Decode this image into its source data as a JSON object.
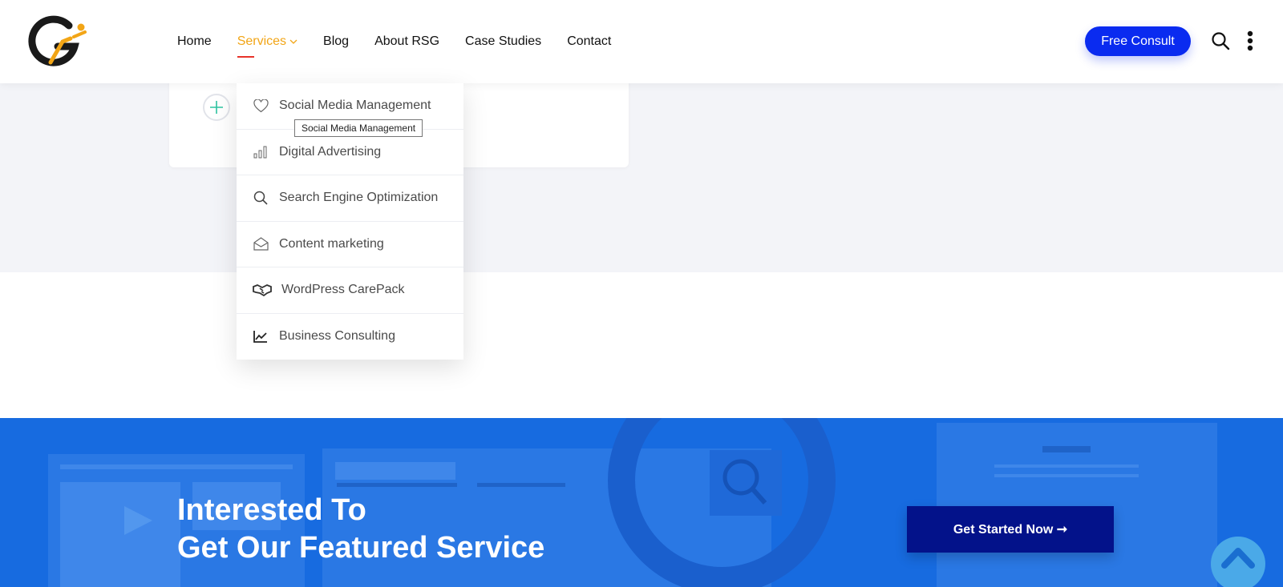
{
  "header": {
    "nav": [
      {
        "label": "Home"
      },
      {
        "label": "Services"
      },
      {
        "label": "Blog"
      },
      {
        "label": "About RSG"
      },
      {
        "label": "Case Studies"
      },
      {
        "label": "Contact"
      }
    ],
    "cta_label": "Free Consult",
    "accent_color": "#f2a516",
    "cta_color": "#0a2bf0"
  },
  "dropdown": {
    "items": [
      {
        "label": "Social Media Management",
        "icon": "heart-icon"
      },
      {
        "label": "Digital Advertising",
        "icon": "bar-chart-icon"
      },
      {
        "label": "Search Engine Optimization",
        "icon": "search-icon"
      },
      {
        "label": "Content marketing",
        "icon": "envelope-open-icon"
      },
      {
        "label": "WordPress CarePack",
        "icon": "handshake-icon"
      },
      {
        "label": "Business Consulting",
        "icon": "line-chart-icon"
      }
    ],
    "tooltip": "Social Media Management"
  },
  "banner": {
    "title_line1": "Interested To",
    "title_line2": "Get Our Featured Service",
    "button_label": "Get Started Now ➞",
    "bg_color": "#176be0",
    "button_color": "#03128a"
  }
}
